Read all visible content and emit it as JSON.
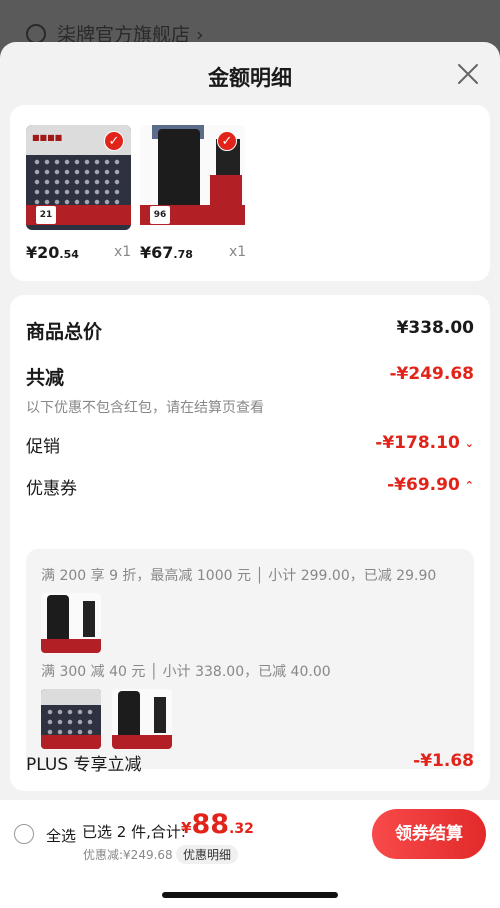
{
  "background": {
    "store_name": "柒牌官方旗舰店 ›"
  },
  "sheet": {
    "title": "金额明细"
  },
  "products": [
    {
      "price_int": "¥20",
      "price_dec": ".54",
      "qty": "x1",
      "badge": "21"
    },
    {
      "price_int": "¥67",
      "price_dec": ".78",
      "qty": "x1",
      "badge": "96"
    }
  ],
  "details": {
    "total_label": "商品总价",
    "total_value": "¥338.00",
    "reduce_label": "共减",
    "reduce_value": "-¥249.68",
    "reduce_note": "以下优惠不包含红包，请在结算页查看",
    "promo_label": "促销",
    "promo_value": "-¥178.10",
    "coupon_label": "优惠券",
    "coupon_value": "-¥69.90",
    "coupon_lines": [
      "满 200 享 9 折，最高减 1000 元 │ 小计 299.00，已减 29.90",
      "满 300 减 40 元 │ 小计 338.00，已减 40.00"
    ],
    "plus_label": "PLUS 专享立减",
    "plus_value": "-¥1.68"
  },
  "bottom": {
    "select_all": "全选",
    "selected": "已选 2 件,合计:",
    "currency": "¥",
    "total_int": "88",
    "total_dec": ".32",
    "discount": "优惠减:¥249.68",
    "detail_link": "优惠明细",
    "checkout": "领券结算"
  },
  "colors": {
    "accent": "#e2231a",
    "button": "#f04040"
  }
}
